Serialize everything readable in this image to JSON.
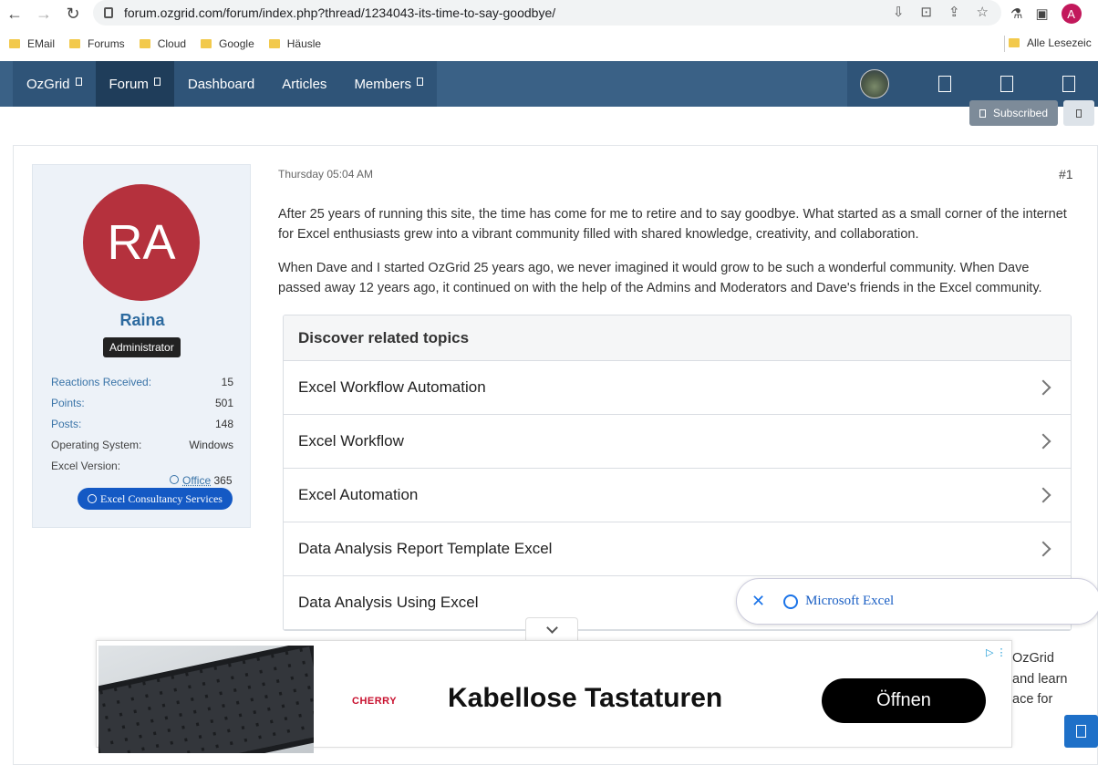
{
  "browser": {
    "url": "forum.ozgrid.com/forum/index.php?thread/1234043-its-time-to-say-goodbye/",
    "profile_initial": "A",
    "bookmarks": [
      "EMail",
      "Forums",
      "Cloud",
      "Google",
      "Häusle"
    ],
    "bookmarks_right": "Alle Lesezeic"
  },
  "site_nav": {
    "items": [
      {
        "label": "OzGrid",
        "has_caret": true
      },
      {
        "label": "Forum",
        "has_caret": true,
        "active": true
      },
      {
        "label": "Dashboard"
      },
      {
        "label": "Articles"
      },
      {
        "label": "Members",
        "has_caret": true
      }
    ],
    "subscribed_label": "Subscribed"
  },
  "post": {
    "date": "Thursday 05:04 AM",
    "number": "#1",
    "paragraphs": [
      "After 25 years of running this site, the time has come for me to retire and to say goodbye. What started as a small corner of the internet for Excel enthusiasts grew into a vibrant community filled with shared knowledge, creativity, and collaboration.",
      "When Dave and I started OzGrid 25 years ago, we never imagined it would grow to be such a wonderful community. When Dave passed away 12 years ago, it continued on with the help of the Admins and Moderators and Dave's friends in the Excel community."
    ],
    "tail_lines": [
      "OzGrid",
      "and learn",
      "ace for"
    ]
  },
  "user": {
    "initials": "RA",
    "name": "Raina",
    "role": "Administrator",
    "stats": {
      "reactions_label": "Reactions Received:",
      "reactions": "15",
      "points_label": "Points:",
      "points": "501",
      "posts_label": "Posts:",
      "posts": "148",
      "os_label": "Operating System:",
      "os": "Windows",
      "excel_label": "Excel Version:",
      "office_link": "Office",
      "office_ver": "365"
    },
    "consult_label": "Excel Consultancy Services"
  },
  "related": {
    "title": "Discover related topics",
    "topics": [
      "Excel Workflow Automation",
      "Excel Workflow",
      "Excel Automation",
      "Data Analysis Report Template Excel",
      "Data Analysis Using Excel"
    ]
  },
  "popover": {
    "close": "✕",
    "label": "Microsoft Excel"
  },
  "ad": {
    "brand": "CHERRY",
    "headline": "Kabellose Tastaturen",
    "button": "Öffnen",
    "info": "▷ ⋮"
  },
  "colors": {
    "nav": "#3a6186",
    "avatar": "#b5313d",
    "username": "#2c6a9f"
  }
}
